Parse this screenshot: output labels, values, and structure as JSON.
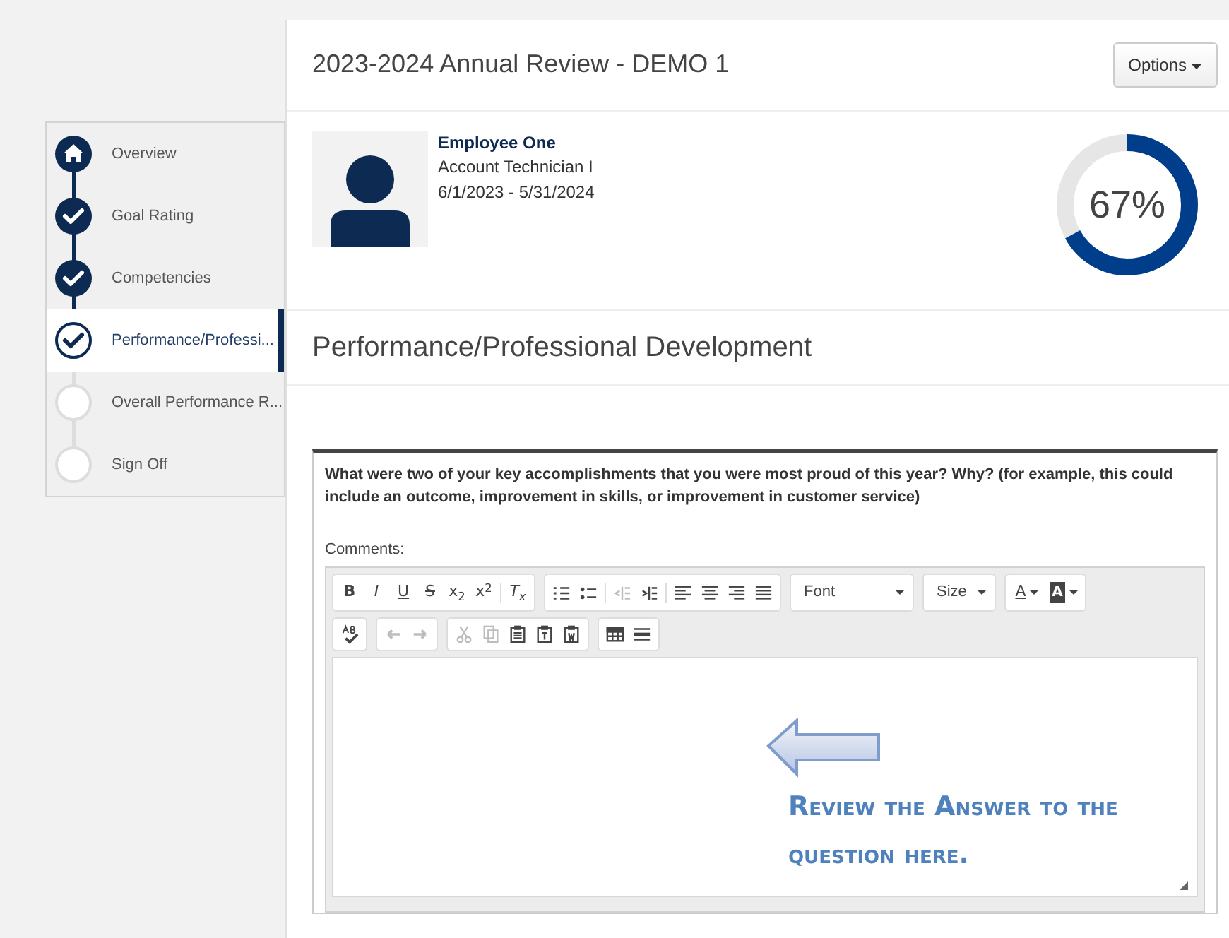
{
  "steps": [
    {
      "label": "Overview",
      "kind": "home",
      "selected": false
    },
    {
      "label": "Goal Rating",
      "kind": "done",
      "selected": false
    },
    {
      "label": "Competencies",
      "kind": "done",
      "selected": false
    },
    {
      "label": "Performance/Professi...",
      "kind": "current",
      "selected": true
    },
    {
      "label": "Overall Performance R...",
      "kind": "pending",
      "selected": false
    },
    {
      "label": "Sign Off",
      "kind": "pending",
      "selected": false
    }
  ],
  "header": {
    "title": "2023-2024 Annual Review - DEMO 1",
    "options_button": "Options"
  },
  "employee": {
    "name": "Employee One",
    "position": "Account Technician I",
    "period": "6/1/2023 - 5/31/2024"
  },
  "progress": {
    "level": 0.67,
    "reading": "67%"
  },
  "section": {
    "title": "Performance/Professional Development"
  },
  "question": {
    "text": "What were two of your key accomplishments that you were most proud of this year? Why? (for example, this could include an outcome, improvement in skills, or improvement in customer service)",
    "comments_label": "Comments:",
    "toolbar": [
      [
        {
          "buttons": [
            {
              "kind": "letter",
              "label": "B",
              "disabled": false
            },
            {
              "kind": "letter",
              "label": "I",
              "disabled": false
            },
            {
              "kind": "letter",
              "label": "U",
              "disabled": false
            },
            {
              "kind": "letter",
              "label": "S",
              "disabled": false
            },
            {
              "kind": "letter",
              "label": "x$_{2}$",
              "disabled": false
            },
            {
              "kind": "letter",
              "label": "x$^{2}$",
              "disabled": false
            },
            {
              "kind": "sep"
            },
            {
              "kind": "letter",
              "label": "T$_{x}$",
              "disabled": false
            }
          ]
        },
        {
          "buttons": [
            {
              "kind": "numbered",
              "disabled": false
            },
            {
              "kind": "bulleted",
              "disabled": false
            },
            {
              "kind": "sep"
            },
            {
              "kind": "outdent",
              "disabled": true
            },
            {
              "kind": "indent",
              "disabled": false
            },
            {
              "kind": "sep"
            },
            {
              "kind": "align-left",
              "disabled": false
            },
            {
              "kind": "align-center",
              "disabled": false
            },
            {
              "kind": "align-right",
              "disabled": false
            },
            {
              "kind": "justify",
              "disabled": false
            }
          ]
        },
        {
          "combo": "Font"
        },
        {
          "combo": "Size"
        },
        {
          "buttons": [
            {
              "kind": "color",
              "label": "A",
              "disabled": false
            },
            {
              "kind": "bgcolor",
              "label": "A",
              "disabled": false
            }
          ]
        }
      ],
      [
        {
          "buttons": [
            {
              "kind": "spellcheck",
              "disabled": false
            }
          ]
        },
        {
          "buttons": [
            {
              "kind": "undo",
              "disabled": true
            },
            {
              "kind": "redo",
              "disabled": true
            }
          ]
        },
        {
          "buttons": [
            {
              "kind": "cut",
              "disabled": true
            },
            {
              "kind": "copy",
              "disabled": true
            },
            {
              "kind": "paste",
              "disabled": false
            },
            {
              "kind": "paste-text",
              "disabled": false
            },
            {
              "kind": "paste-word",
              "disabled": false
            }
          ]
        },
        {
          "buttons": [
            {
              "kind": "table",
              "disabled": false
            },
            {
              "kind": "hline",
              "disabled": false
            }
          ]
        }
      ]
    ],
    "annotation": "Review the Answer to the question here."
  }
}
